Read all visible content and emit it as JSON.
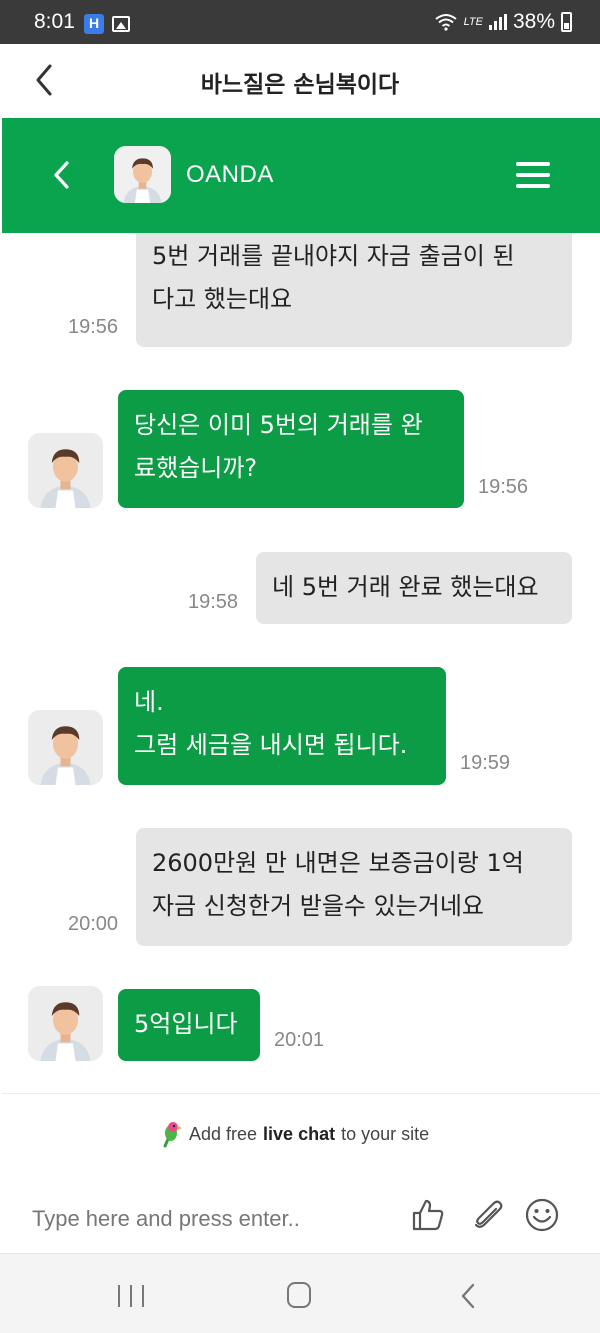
{
  "status_bar": {
    "time": "8:01",
    "battery": "38%",
    "network": "LTE"
  },
  "browser": {
    "title": "바느질은 손님복이다"
  },
  "chat": {
    "agent_name": "OANDA",
    "accent_color": "#0aa44e"
  },
  "messages": [
    {
      "side": "out",
      "lines": [
        "5번 거래를 끝내야지 자금 출금이 된",
        "다고 했는대요"
      ],
      "time": "19:56"
    },
    {
      "side": "in",
      "lines": [
        "당신은 이미 5번의 거래를 완",
        "료했습니까?"
      ],
      "time": "19:56"
    },
    {
      "side": "out",
      "lines": [
        "네 5번 거래 완료 했는대요"
      ],
      "time": "19:58"
    },
    {
      "side": "in",
      "lines": [
        "네.",
        "그럼 세금을 내시면 됩니다."
      ],
      "time": "19:59"
    },
    {
      "side": "out",
      "lines": [
        "2600만원 만 내면은 보증금이랑 1억",
        "자금 신청한거 받을수 있는거네요"
      ],
      "time": "20:00"
    },
    {
      "side": "in",
      "lines": [
        "5억입니다"
      ],
      "time": "20:01"
    }
  ],
  "promo": {
    "prefix": "Add free",
    "bold": "live chat",
    "suffix": "to your site"
  },
  "input": {
    "placeholder": "Type here and press enter.."
  }
}
